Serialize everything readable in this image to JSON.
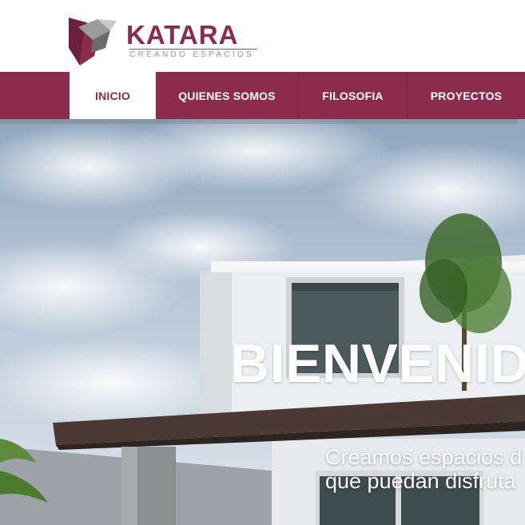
{
  "brand": {
    "name": "KATARA",
    "tagline": "CREANDO ESPACIOS",
    "color": "#8c2b4c"
  },
  "nav": {
    "items": [
      {
        "label": "INICIO",
        "active": true
      },
      {
        "label": "QUIENES SOMOS",
        "active": false
      },
      {
        "label": "FILOSOFIA",
        "active": false
      },
      {
        "label": "PROYECTOS",
        "active": false
      }
    ]
  },
  "hero": {
    "title": "BIENVENIDO",
    "subtitle_line1": "Creamos espacios d",
    "subtitle_line2": "que puedan disfruta"
  }
}
